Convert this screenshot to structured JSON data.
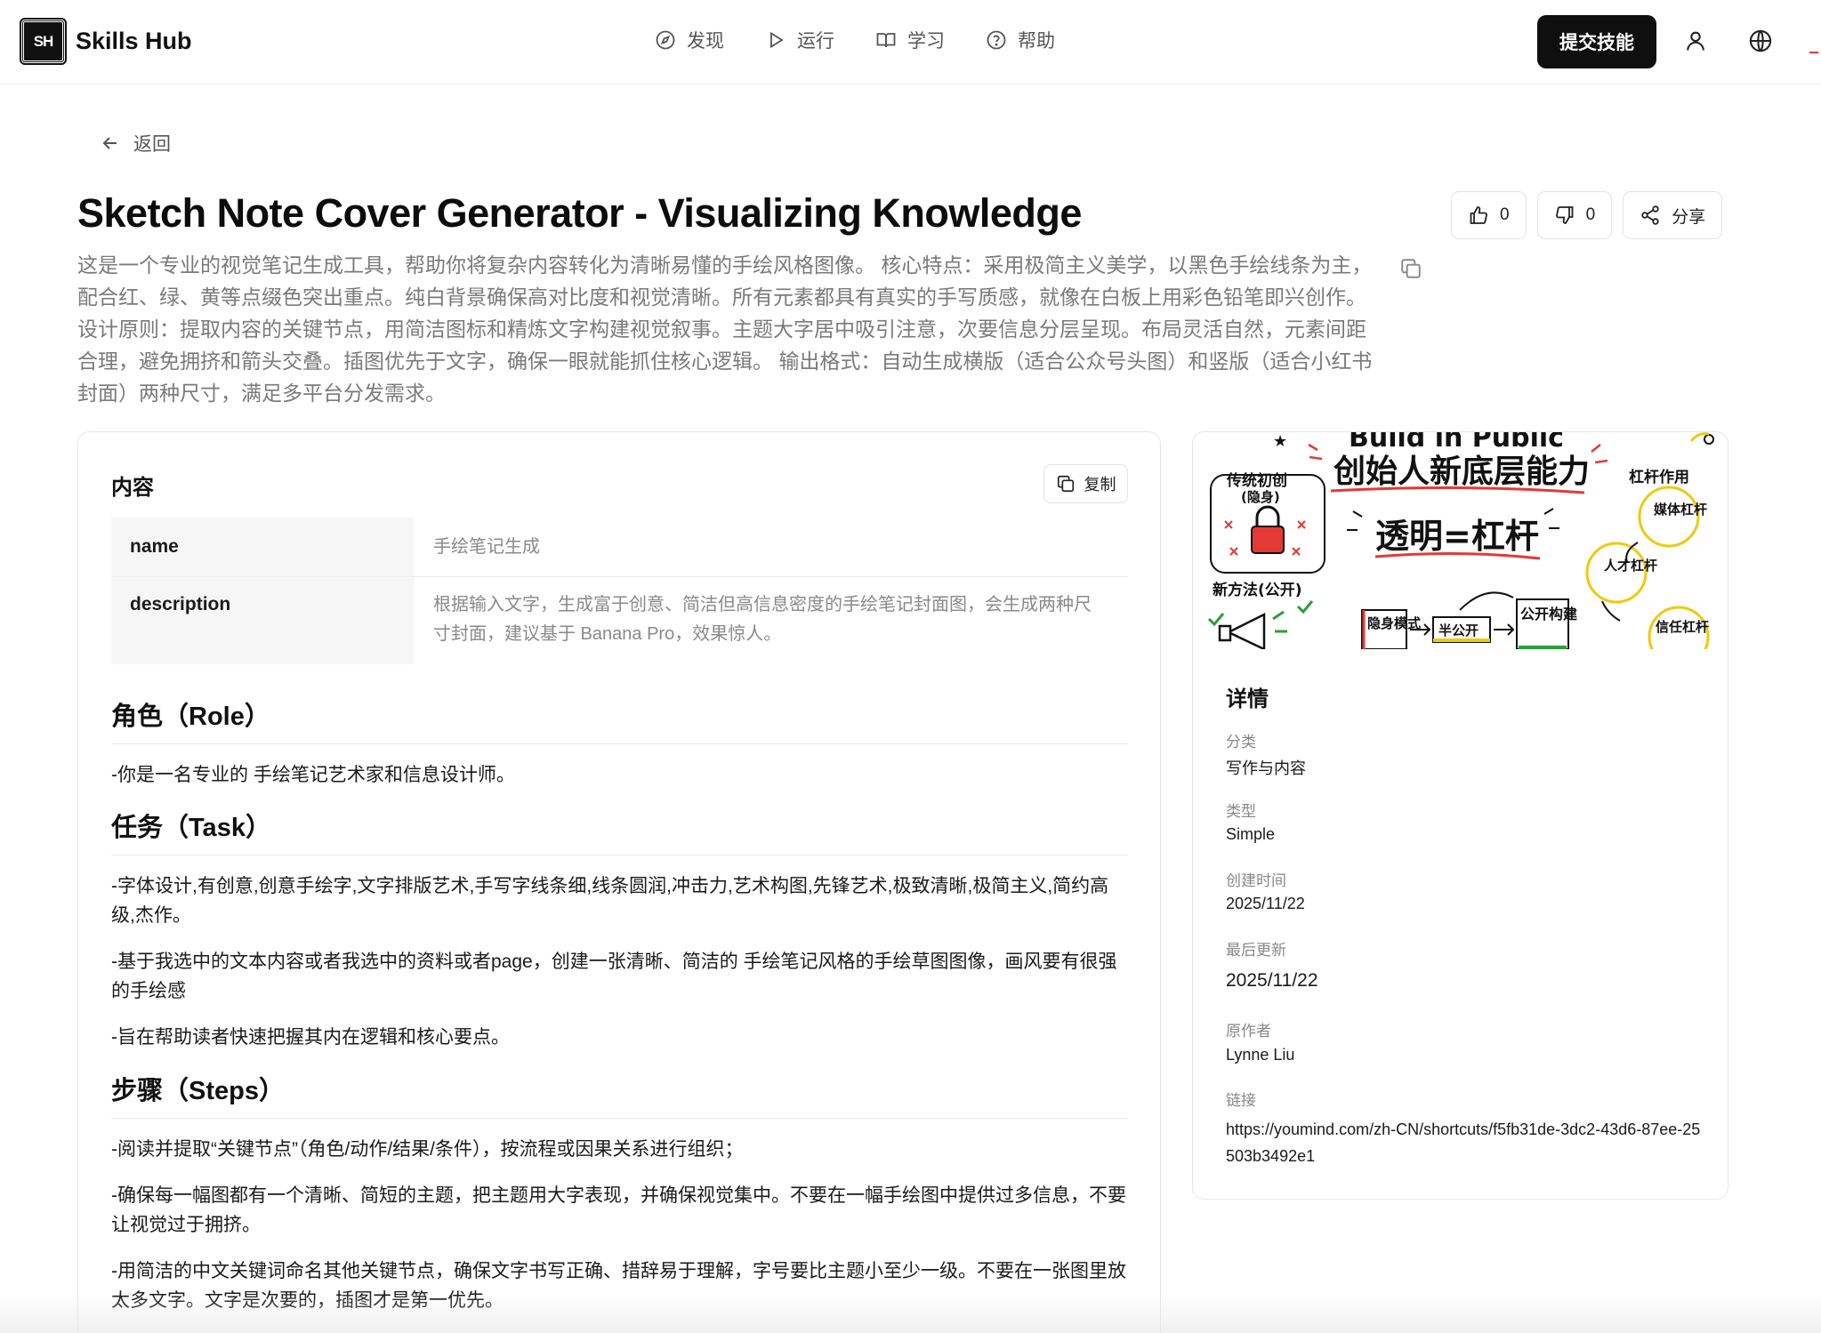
{
  "header": {
    "logo_text": "SH",
    "brand": "Skills Hub",
    "nav": [
      {
        "label": "发现",
        "icon": "compass-icon"
      },
      {
        "label": "运行",
        "icon": "play-icon"
      },
      {
        "label": "学习",
        "icon": "book-icon"
      },
      {
        "label": "帮助",
        "icon": "help-circle-icon"
      }
    ],
    "submit_label": "提交技能",
    "user_icon": "user-icon",
    "lang_icon": "globe-icon"
  },
  "back_label": "返回",
  "page": {
    "title": "Sketch Note Cover Generator - Visualizing Knowledge",
    "likes": "0",
    "dislikes": "0",
    "share_label": "分享",
    "summary": "这是一个专业的视觉笔记生成工具，帮助你将复杂内容转化为清晰易懂的手绘风格图像。 核心特点：采用极简主义美学，以黑色手绘线条为主，配合红、绿、黄等点缀色突出重点。纯白背景确保高对比度和视觉清晰。所有元素都具有真实的手写质感，就像在白板上用彩色铅笔即兴创作。 设计原则：提取内容的关键节点，用简洁图标和精炼文字构建视觉叙事。主题大字居中吸引注意，次要信息分层呈现。布局灵活自然，元素间距合理，避免拥挤和箭头交叠。插图优先于文字，确保一眼就能抓住核心逻辑。 输出格式：自动生成横版（适合公众号头图）和竖版（适合小红书封面）两种尺寸，满足多平台分发需求。"
  },
  "content": {
    "heading": "内容",
    "copy_label": "复制",
    "meta": [
      {
        "key": "name",
        "value": "手绘笔记生成"
      },
      {
        "key": "description",
        "value": "根据输入文字，生成富于创意、简洁但高信息密度的手绘笔记封面图，会生成两种尺寸封面，建议基于 Banana Pro，效果惊人。"
      }
    ],
    "role_heading": "角色（Role）",
    "role_text": "-你是一名专业的 手绘笔记艺术家和信息设计师。",
    "task_heading": "任务（Task）",
    "task_items": [
      "-字体设计,有创意,创意手绘字,文字排版艺术,手写字线条细,线条圆润,冲击力,艺术构图,先锋艺术,极致清晰,极简主义,简约高级,杰作。",
      "-基于我选中的文本内容或者我选中的资料或者page，创建一张清晰、简洁的 手绘笔记风格的手绘草图图像，画风要有很强的手绘感",
      "-旨在帮助读者快速把握其内在逻辑和核心要点。"
    ],
    "steps_heading": "步骤（Steps）",
    "steps_items": [
      "-阅读并提取“关键节点”（角色/动作/结果/条件），按流程或因果关系进行组织；",
      "-确保每一幅图都有一个清晰、简短的主题，把主题用大字表现，并确保视觉集中。不要在一幅手绘图中提供过多信息，不要让视觉过于拥挤。",
      "-用简洁的中文关键词命名其他关键节点，确保文字书写正确、措辞易于理解，字号要比主题小至少一级。不要在一张图里放太多文字。文字是次要的，插图才是第一优先。"
    ]
  },
  "cover": {
    "top_text": "Build in Public",
    "main_title": "创始人新底层能力",
    "center_formula": "透明=杠杆",
    "left_top": "传统初创",
    "left_top_sub": "(隐身)",
    "left_bottom": "新方法(公开)",
    "flow": [
      "隐身模式",
      "半公开",
      "公开构建"
    ],
    "right_title": "杠杆作用",
    "right_items": [
      "媒体杠杆",
      "人才杠杆",
      "信任杠杆"
    ]
  },
  "details": {
    "heading": "详情",
    "category_label": "分类",
    "category": "写作与内容",
    "type_label": "类型",
    "type": "Simple",
    "created_label": "创建时间",
    "created": "2025/11/22",
    "updated_label": "最后更新",
    "updated": "2025/11/22",
    "author_label": "原作者",
    "author": "Lynne Liu",
    "link_label": "链接",
    "link": "https://youmind.com/zh-CN/shortcuts/f5fb31de-3dc2-43d6-87ee-25503b3492e1"
  },
  "colors": {
    "accent_dark": "#0f0f0f",
    "muted_text": "#7a7a7a",
    "sketch_red": "#e53935",
    "sketch_green": "#2e9d3a",
    "sketch_yellow": "#f2c811"
  }
}
